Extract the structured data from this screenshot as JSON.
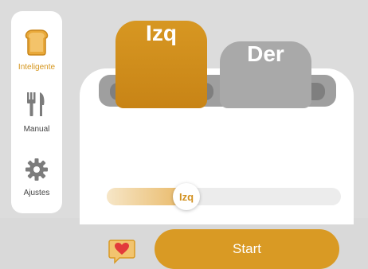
{
  "sidebar": {
    "items": [
      {
        "label": "Inteligente",
        "icon": "toast-icon",
        "active": true
      },
      {
        "label": "Manual",
        "icon": "fork-knife-icon",
        "active": false
      },
      {
        "label": "Ajustes",
        "icon": "gear-icon",
        "active": false
      }
    ]
  },
  "toaster": {
    "left_slot_label": "Izq",
    "right_slot_label": "Der",
    "selected_slot": "Izq",
    "slider": {
      "thumb_label": "Izq",
      "value": 0.34
    }
  },
  "actions": {
    "favorite_icon": "heart-speech-bubble-icon",
    "start_label": "Start"
  },
  "colors": {
    "accent": "#d99a24",
    "inactive_slot": "#a9a9a9",
    "background": "#dcdcdc"
  }
}
